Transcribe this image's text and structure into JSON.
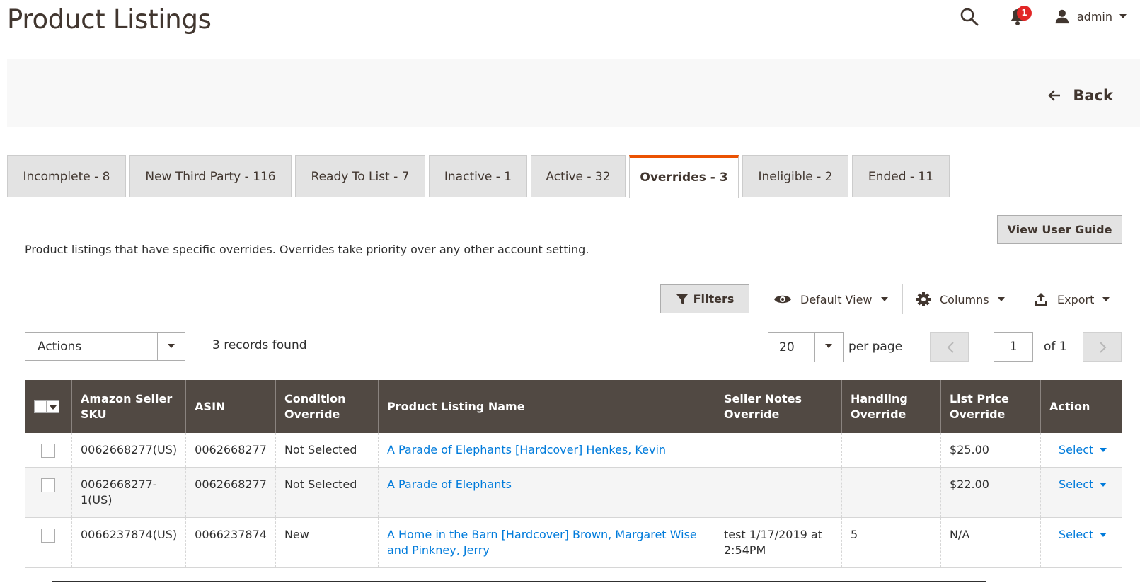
{
  "page": {
    "title": "Product Listings"
  },
  "header": {
    "notification_count": "1",
    "user_name": "admin"
  },
  "actions": {
    "back_label": "Back"
  },
  "tabs": [
    {
      "label": "Incomplete - 8",
      "active": false
    },
    {
      "label": "New Third Party - 116",
      "active": false
    },
    {
      "label": "Ready To List - 7",
      "active": false
    },
    {
      "label": "Inactive - 1",
      "active": false
    },
    {
      "label": "Active - 32",
      "active": false
    },
    {
      "label": "Overrides - 3",
      "active": true
    },
    {
      "label": "Ineligible - 2",
      "active": false
    },
    {
      "label": "Ended - 11",
      "active": false
    }
  ],
  "info": {
    "description": "Product listings that have specific overrides. Overrides take priority over any other account setting.",
    "guide_button": "View User Guide"
  },
  "toolbar": {
    "filters": "Filters",
    "default_view": "Default View",
    "columns": "Columns",
    "export": "Export"
  },
  "grid_controls": {
    "actions_label": "Actions",
    "records_found": "3 records found",
    "per_page_value": "20",
    "per_page_label": "per page",
    "current_page": "1",
    "of_pages": "of 1"
  },
  "columns": [
    {
      "label": "Amazon Seller SKU"
    },
    {
      "label": "ASIN"
    },
    {
      "label": "Condition Override"
    },
    {
      "label": "Product Listing Name"
    },
    {
      "label": "Seller Notes Override"
    },
    {
      "label": "Handling Override"
    },
    {
      "label": "List Price Override"
    },
    {
      "label": "Action"
    }
  ],
  "rows": [
    {
      "sku": "0062668277(US)",
      "asin": "0062668277",
      "condition": "Not Selected",
      "name": "A Parade of Elephants [Hardcover] Henkes, Kevin",
      "notes": "",
      "handling": "",
      "price": "$25.00",
      "action": "Select"
    },
    {
      "sku": "0062668277-1(US)",
      "asin": "0062668277",
      "condition": "Not Selected",
      "name": "A Parade of Elephants",
      "notes": "",
      "handling": "",
      "price": "$22.00",
      "action": "Select"
    },
    {
      "sku": "0066237874(US)",
      "asin": "0066237874",
      "condition": "New",
      "name": "A Home in the Barn [Hardcover] Brown, Margaret Wise and Pinkney, Jerry",
      "notes": "test 1/17/2019 at 2:54PM",
      "handling": "5",
      "price": "N/A",
      "action": "Select"
    }
  ],
  "colors": {
    "accent_tab": "#eb5202",
    "grid_header": "#514943",
    "link": "#007bdb",
    "badge": "#e22626"
  }
}
